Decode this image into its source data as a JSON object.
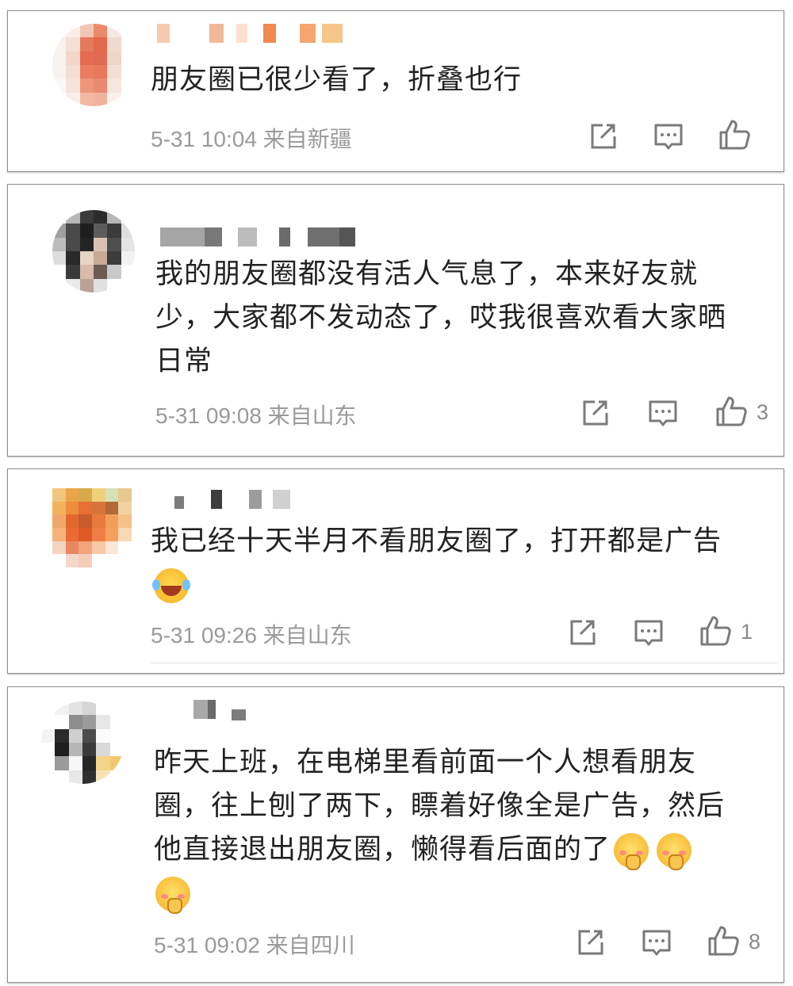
{
  "comments": [
    {
      "text": "朋友圈已很少看了，折叠也行",
      "date": "5-31 10:04",
      "location": "来自新疆",
      "likes": ""
    },
    {
      "text_lines": [
        "我的朋友圈都没有活人气息了，本来好友就",
        "少，大家都不发动态了，哎我很喜欢看大家晒",
        "日常"
      ],
      "date": "5-31 09:08",
      "location": "来自山东",
      "likes": "3"
    },
    {
      "text": "我已经十天半月不看朋友圈了，打开都是广告",
      "emoji": [
        "laughing-crying-emoji"
      ],
      "date": "5-31 09:26",
      "location": "来自山东",
      "likes": "1"
    },
    {
      "text_lines": [
        "昨天上班，在电梯里看前面一个人想看朋友",
        "圈，往上刨了两下，瞟着好像全是广告，然后",
        "他直接退出朋友圈，懒得看后面的了"
      ],
      "emoji": [
        "shy-face-emoji",
        "shy-face-emoji",
        "shy-face-emoji"
      ],
      "date": "5-31 09:02",
      "location": "来自四川",
      "likes": "8"
    }
  ],
  "icons": {
    "share": "share-icon",
    "comment": "comment-icon",
    "like": "thumbs-up-icon"
  },
  "colors": {
    "text": "#222222",
    "meta": "#9a9a9a",
    "border": "#8f8f8f"
  }
}
